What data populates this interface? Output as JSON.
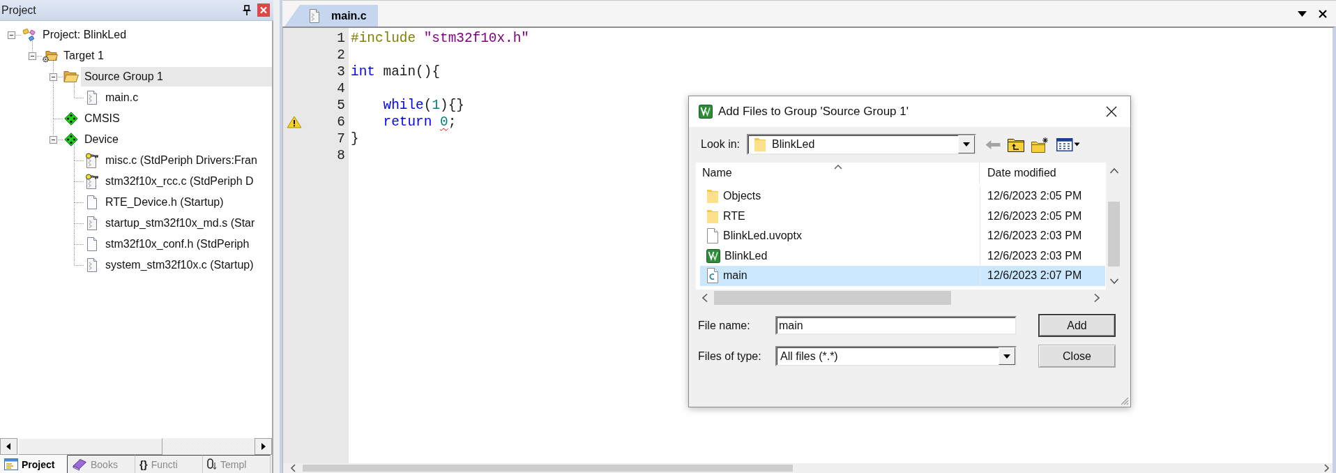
{
  "project_panel": {
    "title": "Project",
    "tree": [
      {
        "label": "Project: BlinkLed",
        "kind": "project",
        "expanded": true,
        "selected": false,
        "children": [
          {
            "label": "Target 1",
            "kind": "target",
            "expanded": true,
            "selected": false,
            "children": [
              {
                "label": "Source Group 1",
                "kind": "group",
                "expanded": true,
                "selected": true,
                "children": [
                  {
                    "label": "main.c",
                    "kind": "source",
                    "selected": false
                  }
                ]
              },
              {
                "label": "CMSIS",
                "kind": "component",
                "selected": false
              },
              {
                "label": "Device",
                "kind": "component",
                "expanded": true,
                "selected": false,
                "children": [
                  {
                    "label": "misc.c (StdPeriph Drivers:Fran",
                    "kind": "locked",
                    "selected": false
                  },
                  {
                    "label": "stm32f10x_rcc.c (StdPeriph D",
                    "kind": "locked",
                    "selected": false
                  },
                  {
                    "label": "RTE_Device.h (Startup)",
                    "kind": "header",
                    "selected": false
                  },
                  {
                    "label": "startup_stm32f10x_md.s (Star",
                    "kind": "source",
                    "selected": false
                  },
                  {
                    "label": "stm32f10x_conf.h (StdPeriph",
                    "kind": "header",
                    "selected": false
                  },
                  {
                    "label": "system_stm32f10x.c (Startup)",
                    "kind": "source",
                    "selected": false
                  }
                ]
              }
            ]
          }
        ]
      }
    ],
    "tabs": [
      {
        "label": "Project",
        "kind": "project",
        "selected": true
      },
      {
        "label": "Books",
        "kind": "books",
        "selected": false
      },
      {
        "label": "Functi",
        "kind": "functions",
        "glyph": "{}",
        "selected": false
      },
      {
        "label": "Templ",
        "kind": "templates",
        "selected": false
      }
    ]
  },
  "editor": {
    "tabs": [
      {
        "label": "main.c",
        "selected": true
      }
    ],
    "lines": [
      {
        "number": "1",
        "warning": false,
        "tokens": [
          {
            "text": "#include",
            "kind": "preprocessor"
          },
          {
            "text": " \"stm32f10x.h\"",
            "kind": "string"
          }
        ]
      },
      {
        "number": "2",
        "warning": false
      },
      {
        "number": "3",
        "warning": false,
        "tokens": [
          {
            "text": "int",
            "kind": "keyword"
          },
          {
            "text": " main(){",
            "kind": "plain"
          }
        ]
      },
      {
        "number": "4",
        "warning": false
      },
      {
        "number": "5",
        "warning": false,
        "tokens": [
          {
            "text": "    while",
            "kind": "keyword"
          },
          {
            "text": "(",
            "kind": "plain"
          },
          {
            "text": "1",
            "kind": "number"
          },
          {
            "text": "){}",
            "kind": "plain"
          }
        ]
      },
      {
        "number": "6",
        "warning": true,
        "tokens": [
          {
            "text": "    return ",
            "kind": "keyword"
          },
          {
            "text": "0",
            "kind": "number",
            "squiggle": true
          },
          {
            "text": ";",
            "kind": "plain"
          }
        ]
      },
      {
        "number": "7",
        "warning": false,
        "tokens": [
          {
            "text": "}",
            "kind": "plain"
          }
        ]
      },
      {
        "number": "8",
        "warning": false
      }
    ]
  },
  "dialog": {
    "title": "Add Files to Group 'Source Group 1'",
    "look_in": {
      "label": "Look in:",
      "value": "BlinkLed"
    },
    "toolbar": [
      {
        "kind": "back",
        "disabled": true
      },
      {
        "kind": "up-folder",
        "disabled": false
      },
      {
        "kind": "new-folder",
        "disabled": false
      },
      {
        "kind": "view-menu",
        "disabled": false
      }
    ],
    "columns": [
      {
        "label": "Name",
        "sorted": true
      },
      {
        "label": "Date modified",
        "sorted": false
      }
    ],
    "files": [
      {
        "name": "Objects",
        "kind": "folder",
        "date": "12/6/2023 2:05 PM",
        "selected": false
      },
      {
        "name": "RTE",
        "kind": "folder",
        "date": "12/6/2023 2:05 PM",
        "selected": false
      },
      {
        "name": "BlinkLed.uvoptx",
        "kind": "file",
        "date": "12/6/2023 2:03 PM",
        "selected": false
      },
      {
        "name": "BlinkLed",
        "kind": "project",
        "date": "12/6/2023 2:03 PM",
        "selected": false
      },
      {
        "name": "main",
        "kind": "c-file",
        "date": "12/6/2023 2:07 PM",
        "selected": true
      }
    ],
    "file_name": {
      "label": "File name:",
      "value": "main"
    },
    "file_type": {
      "label": "Files of type:",
      "value": "All files (*.*)"
    },
    "buttons": [
      {
        "label": "Add",
        "default": true
      },
      {
        "label": "Close",
        "default": false
      }
    ]
  }
}
